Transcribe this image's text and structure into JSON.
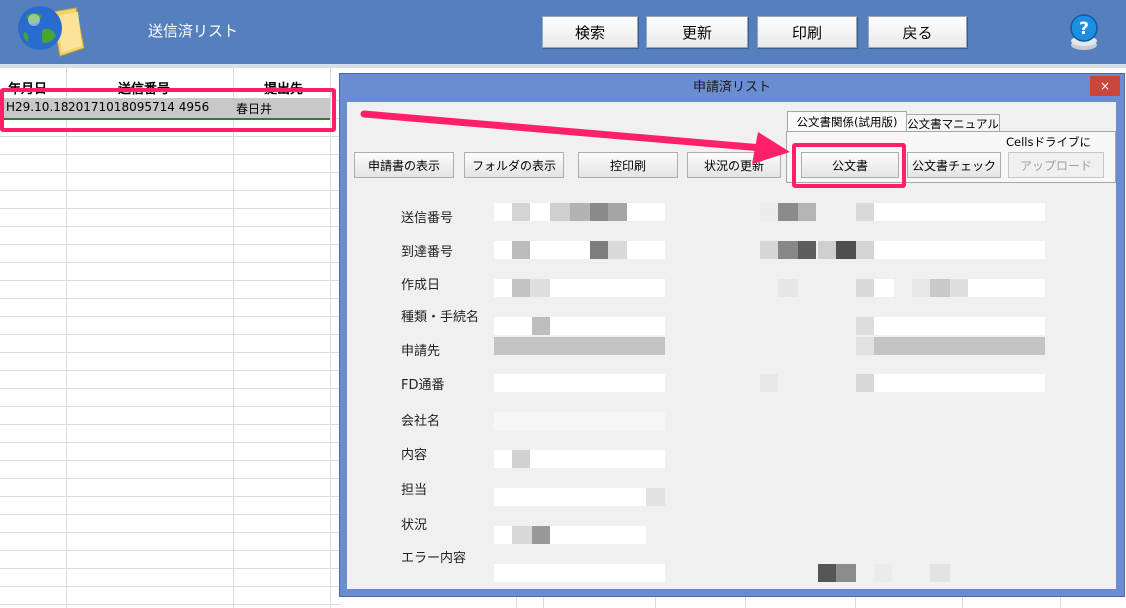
{
  "header": {
    "title": "送信済リスト",
    "buttons": {
      "search": "検索",
      "refresh": "更新",
      "print": "印刷",
      "back": "戻る"
    },
    "help_icon": "question-mark-icon",
    "app_icon": "globe-folder-icon"
  },
  "sheet": {
    "headers": [
      "年月日",
      "送信番号",
      "提出先"
    ],
    "row": {
      "date": "H29.10.18",
      "number": "20171018095714 4956",
      "dest": "春日井"
    }
  },
  "dialog": {
    "title": "申請済リスト",
    "close": "×",
    "tabs": {
      "tab1": "公文書関係(試用版)",
      "tab2": "公文書マニュアル"
    },
    "cells_caption": "Cellsドライブに",
    "buttons": {
      "show_application": "申請書の表示",
      "show_folder": "フォルダの表示",
      "copy_print": "控印刷",
      "status_update": "状況の更新",
      "official_doc": "公文書",
      "official_check": "公文書チェック",
      "upload": "アップロード"
    },
    "labels": {
      "send_no": "送信番号",
      "arrival_no": "到達番号",
      "created": "作成日",
      "kind": "種類・手続名",
      "applicant": "申請先",
      "fd_no": "FD通番",
      "company": "会社名",
      "content": "内容",
      "person": "担当",
      "status": "状況",
      "error": "エラー内容"
    }
  },
  "colors": {
    "header_bg": "#5580bd",
    "highlight": "#ff1f6a",
    "dialog_frame": "#6a8cd1",
    "close_button": "#c9463d"
  }
}
